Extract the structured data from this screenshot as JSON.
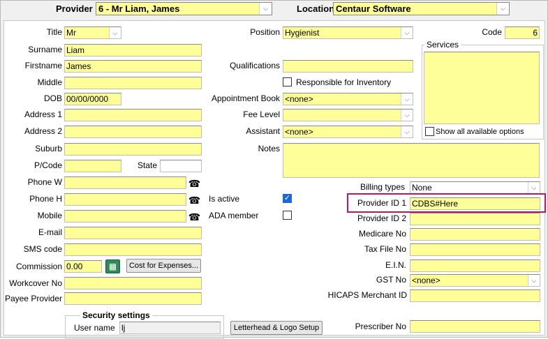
{
  "topbar": {
    "provider_label": "Provider",
    "provider_value": "6 - Mr Liam, James",
    "location_label": "Location",
    "location_value": "Centaur Software"
  },
  "form": {
    "title_label": "Title",
    "title_value": "Mr",
    "surname_label": "Surname",
    "surname_value": "Liam",
    "firstname_label": "Firstname",
    "firstname_value": "James",
    "middle_label": "Middle",
    "middle_value": "",
    "dob_label": "DOB",
    "dob_value": "00/00/0000",
    "address1_label": "Address 1",
    "address1_value": "",
    "address2_label": "Address 2",
    "address2_value": "",
    "suburb_label": "Suburb",
    "suburb_value": "",
    "pcode_label": "P/Code",
    "pcode_value": "",
    "state_label": "State",
    "state_value": "",
    "phonew_label": "Phone W",
    "phonew_value": "",
    "phoneh_label": "Phone H",
    "phoneh_value": "",
    "mobile_label": "Mobile",
    "mobile_value": "",
    "email_label": "E-mail",
    "email_value": "",
    "sms_label": "SMS code",
    "sms_value": "",
    "commission_label": "Commission",
    "commission_value": "0.00",
    "cost_button": "Cost for Expenses...",
    "workcover_label": "Workcover No",
    "workcover_value": "",
    "payee_label": "Payee Provider",
    "payee_value": "",
    "position_label": "Position",
    "position_value": "Hygienist",
    "qualifications_label": "Qualifications",
    "qualifications_value": "",
    "responsible_label": "Responsible for Inventory",
    "appointment_label": "Appointment Book",
    "appointment_value": "<none>",
    "fee_label": "Fee Level",
    "fee_value": "",
    "assistant_label": "Assistant",
    "assistant_value": "<none>",
    "notes_label": "Notes",
    "notes_value": "",
    "is_active_label": "Is active",
    "ada_label": "ADA member",
    "code_label": "Code",
    "code_value": "6",
    "services_label": "Services",
    "show_all_label": "Show all available options",
    "billing_label": "Billing types",
    "billing_value": "None",
    "pid1_label": "Provider ID 1",
    "pid1_value": "CDBS#Here",
    "pid2_label": "Provider ID 2",
    "pid2_value": "",
    "medicare_label": "Medicare No",
    "medicare_value": "",
    "taxfile_label": "Tax File No",
    "taxfile_value": "",
    "ein_label": "E.I.N.",
    "ein_value": "",
    "gst_label": "GST No",
    "gst_value": "<none>",
    "hicaps_label": "HICAPS Merchant ID",
    "hicaps_value": "",
    "prescriber_label": "Prescriber No",
    "prescriber_value": "",
    "security_title": "Security settings",
    "username_label": "User name",
    "username_value": "lj",
    "letterhead_button": "Letterhead & Logo Setup"
  },
  "glyphs": {
    "arrow": "⌵",
    "phone": "☎",
    "check": "✓",
    "calc": "▦"
  },
  "colors": {
    "field": "#ffff99",
    "highlight": "#c8135a",
    "checkbox_on": "#1b66d8"
  },
  "icons": {
    "phone": "phone-icon",
    "calculator": "calculator-icon",
    "dropdown": "chevron-down-icon"
  }
}
